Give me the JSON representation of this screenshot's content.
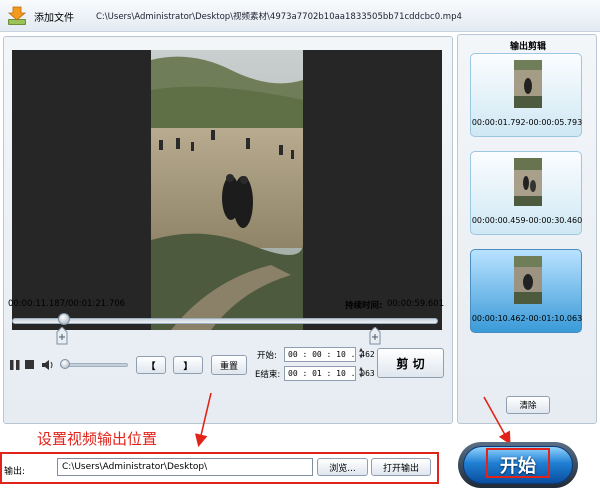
{
  "toolbar": {
    "add_file_label": "添加文件",
    "file_path": "C:\\Users\\Administrator\\Desktop\\视频素材\\4973a7702b10aa1833505bb71cddcbc0.mp4"
  },
  "player": {
    "current_time": "00:00:11.187/00:01:21.706",
    "duration_label": "持续时间:",
    "duration_value": "00:00:59.601",
    "seek_position": 0.137,
    "volume_level": 0.0
  },
  "controls": {
    "mark_in_label": "【",
    "mark_out_label": "】",
    "reset_label": "重置",
    "start_label": "开始:",
    "end_label": "E结束:",
    "start_time": "00 : 00 : 10 . 462",
    "end_time": "00 : 01 : 10 . 063",
    "cut_label": "剪 切"
  },
  "clips_panel": {
    "title": "输出剪辑",
    "clips": [
      {
        "label": "00:00:01.792-00:00:05.793",
        "selected": false
      },
      {
        "label": "00:00:00.459-00:00:30.460",
        "selected": false
      },
      {
        "label": "00:00:10.462-00:01:10.063",
        "selected": true
      }
    ],
    "clear_label": "清除"
  },
  "annotation": {
    "text": "设置视频输出位置",
    "color": "#e2231a"
  },
  "output": {
    "label": "输出:",
    "path": "C:\\Users\\Administrator\\Desktop\\",
    "browse_label": "浏览...",
    "open_label": "打开输出"
  },
  "start_button": {
    "label": "开始"
  },
  "icons": [
    "download-arrow-icon",
    "pause-icon",
    "stop-icon",
    "volume-icon",
    "marker-icon",
    "spin-icon"
  ]
}
